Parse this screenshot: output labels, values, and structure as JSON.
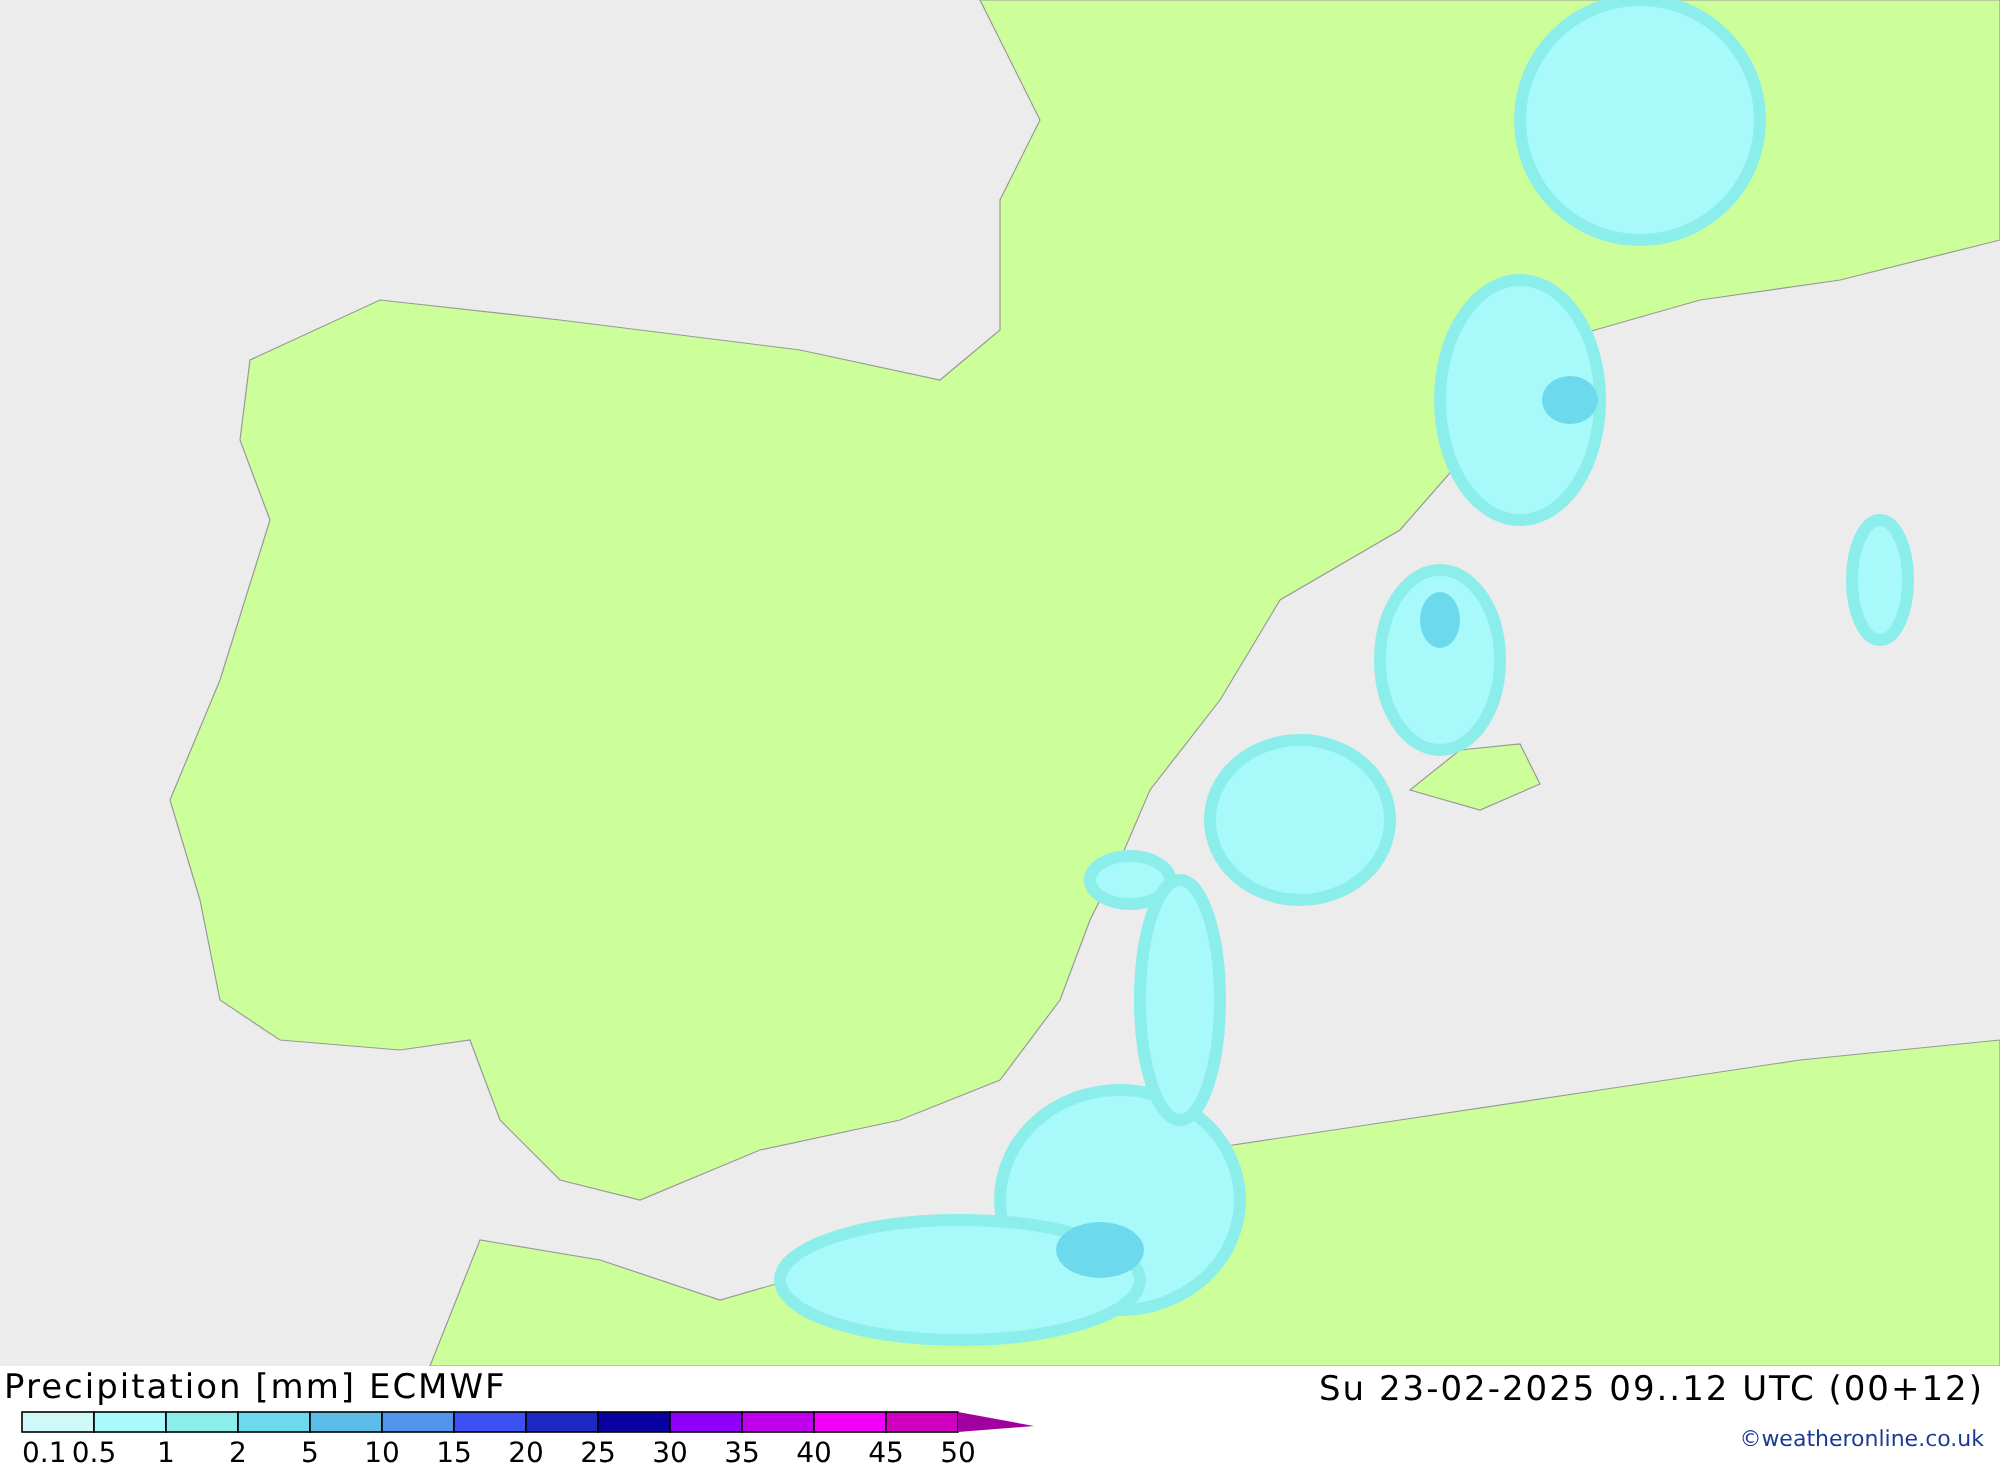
{
  "title": "Precipitation [mm] ECMWF",
  "valid_time": "Su 23-02-2025 09..12 UTC (00+12)",
  "credit": "©weatheronline.co.uk",
  "legend": [
    {
      "label": "0.1",
      "color": "#cff8f8"
    },
    {
      "label": "0.5",
      "color": "#a8fafa"
    },
    {
      "label": "1",
      "color": "#8ceeea"
    },
    {
      "label": "2",
      "color": "#6cdaec"
    },
    {
      "label": "5",
      "color": "#5cbce8"
    },
    {
      "label": "10",
      "color": "#5094ec"
    },
    {
      "label": "15",
      "color": "#3c50f4"
    },
    {
      "label": "20",
      "color": "#1c28c0"
    },
    {
      "label": "25",
      "color": "#0800a0"
    },
    {
      "label": "30",
      "color": "#9000f8"
    },
    {
      "label": "35",
      "color": "#c000ec"
    },
    {
      "label": "40",
      "color": "#f000f8"
    },
    {
      "label": "45",
      "color": "#d000c0"
    },
    {
      "label": "50",
      "color": "#a000a0"
    }
  ]
}
